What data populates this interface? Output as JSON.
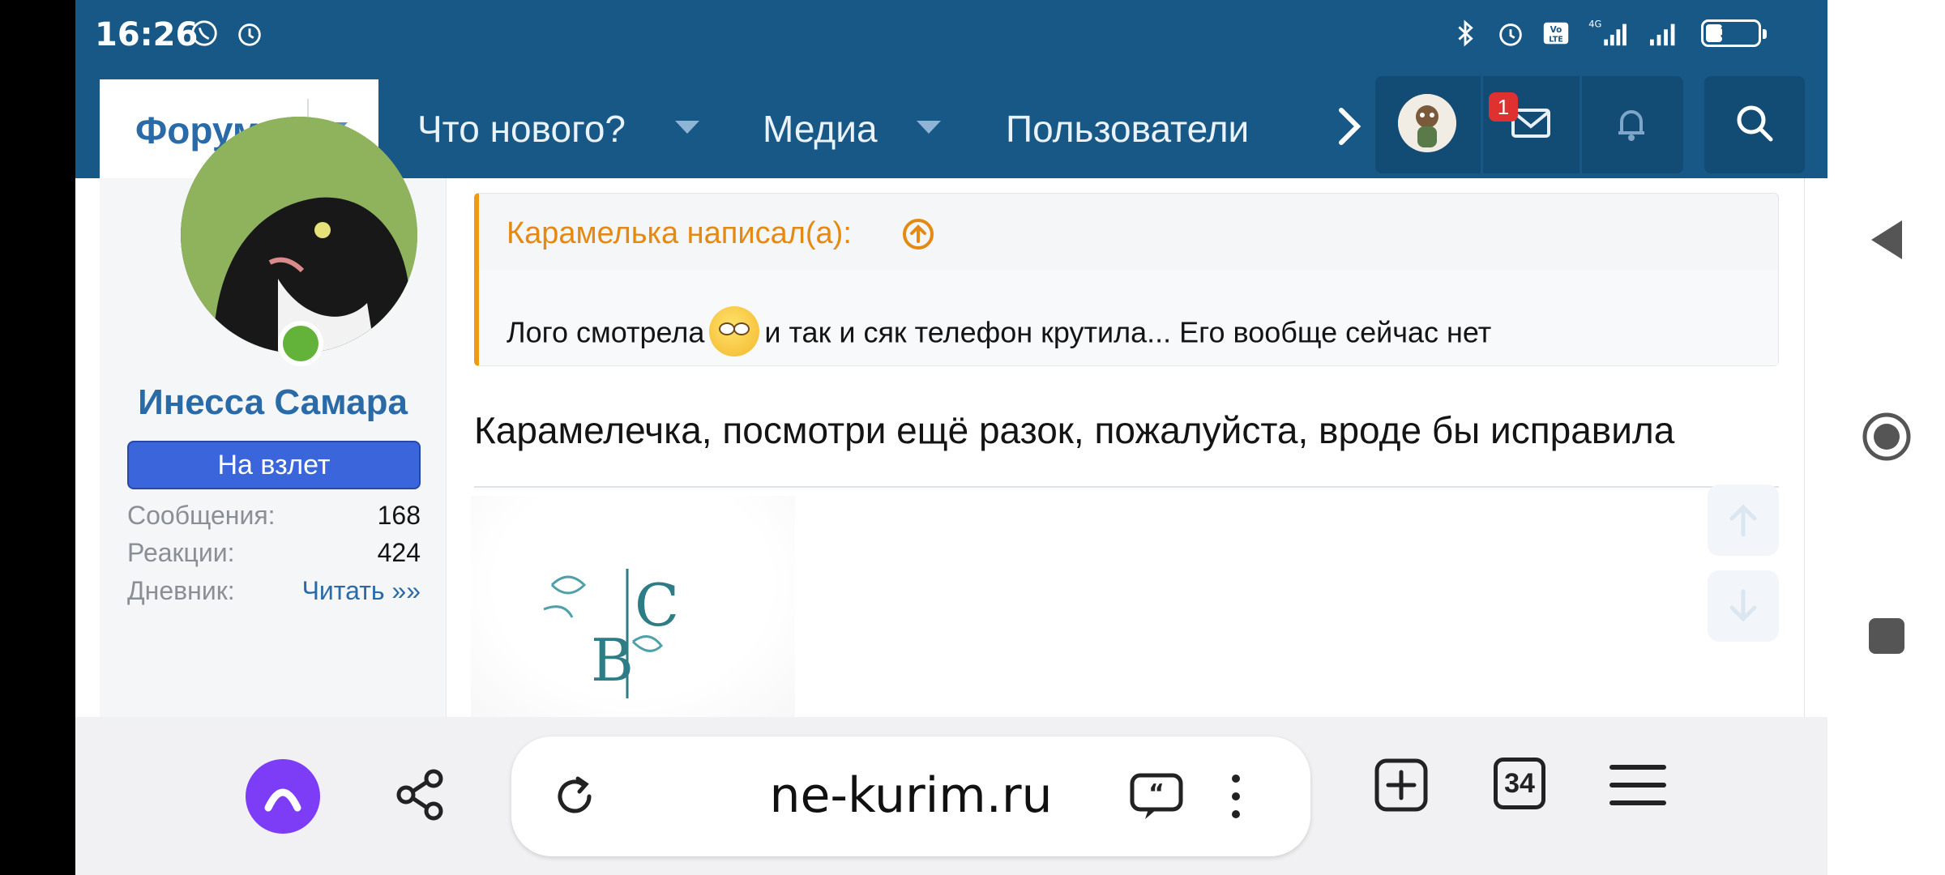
{
  "status_bar": {
    "time": "16:26",
    "battery": "33",
    "battery_level": 0.33
  },
  "nav": {
    "active": "Форумы",
    "items": [
      "Что нового?",
      "Медиа",
      "Пользователи"
    ],
    "notification_count": "1"
  },
  "user": {
    "name": "Инесса Самара",
    "title": "На взлет",
    "stats": [
      {
        "label": "Сообщения:",
        "value": "168"
      },
      {
        "label": "Реакции:",
        "value": "424"
      },
      {
        "label": "Дневник:",
        "value": "Читать »»"
      }
    ]
  },
  "quote": {
    "author": "Карамелька написал(а):",
    "text_before": "Лого смотрела",
    "text_after": "и так и сяк телефон крутила... Его вообще сейчас нет"
  },
  "post": {
    "text": "Карамелечка, посмотри ещё разок, пожалуйста, вроде бы исправила"
  },
  "browser": {
    "url": "ne-kurim.ru",
    "tabs_count": "34"
  },
  "colors": {
    "header": "#185886",
    "accent_link": "#2a6aa6",
    "quote_orange": "#f09a14",
    "title_badge": "#3b66db",
    "alice": "#7d3cf5"
  }
}
